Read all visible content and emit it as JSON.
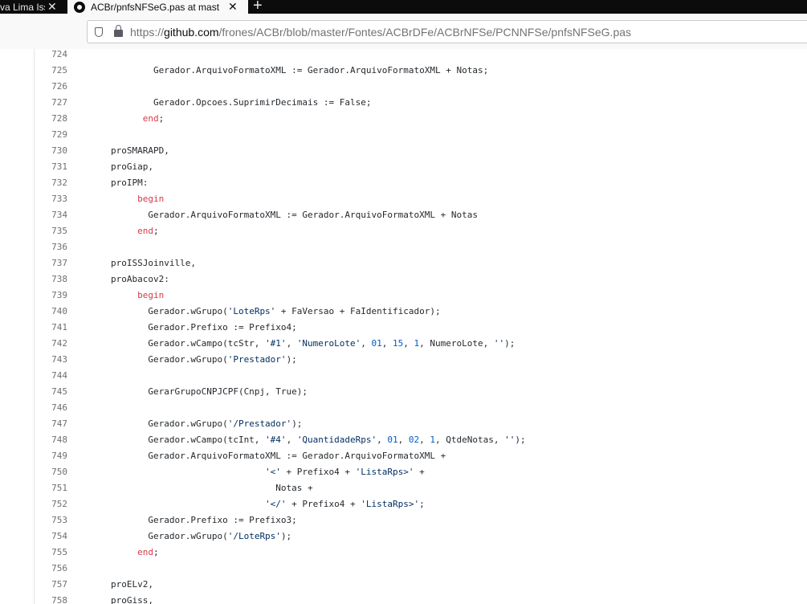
{
  "tabs": [
    {
      "title": "va Lima Iss",
      "active": false,
      "close": "✕"
    },
    {
      "title": "ACBr/pnfsNFSeG.pas at master",
      "active": true,
      "close": "✕"
    }
  ],
  "new_tab_label": "+",
  "address": {
    "scheme": "https://",
    "host": "github.com",
    "path": "/frones/ACBr/blob/master/Fontes/ACBrDFe/ACBrNFSe/PCNNFSe/pnfsNFSeG.pas"
  },
  "code": {
    "lines": [
      {
        "n": "724",
        "segs": []
      },
      {
        "n": "725",
        "segs": [
          {
            "t": "        Gerador.ArquivoFormatoXML := Gerador.ArquivoFormatoXML + Notas;",
            "c": ""
          }
        ]
      },
      {
        "n": "726",
        "segs": []
      },
      {
        "n": "727",
        "segs": [
          {
            "t": "        Gerador.Opcoes.SuprimirDecimais := False;",
            "c": ""
          }
        ]
      },
      {
        "n": "728",
        "segs": [
          {
            "t": "      ",
            "c": ""
          },
          {
            "t": "end",
            "c": "kw"
          },
          {
            "t": ";",
            "c": ""
          }
        ]
      },
      {
        "n": "729",
        "segs": []
      },
      {
        "n": "730",
        "segs": [
          {
            "t": "proSMARAPD,",
            "c": ""
          }
        ]
      },
      {
        "n": "731",
        "segs": [
          {
            "t": "proGiap,",
            "c": ""
          }
        ]
      },
      {
        "n": "732",
        "segs": [
          {
            "t": "proIPM:",
            "c": ""
          }
        ]
      },
      {
        "n": "733",
        "segs": [
          {
            "t": "     ",
            "c": ""
          },
          {
            "t": "begin",
            "c": "kw"
          }
        ]
      },
      {
        "n": "734",
        "segs": [
          {
            "t": "       Gerador.ArquivoFormatoXML := Gerador.ArquivoFormatoXML + Notas",
            "c": ""
          }
        ]
      },
      {
        "n": "735",
        "segs": [
          {
            "t": "     ",
            "c": ""
          },
          {
            "t": "end",
            "c": "kw"
          },
          {
            "t": ";",
            "c": ""
          }
        ]
      },
      {
        "n": "736",
        "segs": []
      },
      {
        "n": "737",
        "segs": [
          {
            "t": "proISSJoinville,",
            "c": ""
          }
        ]
      },
      {
        "n": "738",
        "segs": [
          {
            "t": "proAbacov2:",
            "c": ""
          }
        ]
      },
      {
        "n": "739",
        "segs": [
          {
            "t": "     ",
            "c": ""
          },
          {
            "t": "begin",
            "c": "kw"
          }
        ]
      },
      {
        "n": "740",
        "segs": [
          {
            "t": "       Gerador.wGrupo(",
            "c": ""
          },
          {
            "t": "'LoteRps'",
            "c": "str"
          },
          {
            "t": " + FaVersao + FaIdentificador);",
            "c": ""
          }
        ]
      },
      {
        "n": "741",
        "segs": [
          {
            "t": "       Gerador.Prefixo := Prefixo4;",
            "c": ""
          }
        ]
      },
      {
        "n": "742",
        "segs": [
          {
            "t": "       Gerador.wCampo(tcStr, ",
            "c": ""
          },
          {
            "t": "'#1'",
            "c": "str"
          },
          {
            "t": ", ",
            "c": ""
          },
          {
            "t": "'NumeroLote'",
            "c": "str"
          },
          {
            "t": ", ",
            "c": ""
          },
          {
            "t": "01",
            "c": "num"
          },
          {
            "t": ", ",
            "c": ""
          },
          {
            "t": "15",
            "c": "num"
          },
          {
            "t": ", ",
            "c": ""
          },
          {
            "t": "1",
            "c": "num"
          },
          {
            "t": ", NumeroLote, ",
            "c": ""
          },
          {
            "t": "''",
            "c": "str"
          },
          {
            "t": ");",
            "c": ""
          }
        ]
      },
      {
        "n": "743",
        "segs": [
          {
            "t": "       Gerador.wGrupo(",
            "c": ""
          },
          {
            "t": "'Prestador'",
            "c": "str"
          },
          {
            "t": ");",
            "c": ""
          }
        ]
      },
      {
        "n": "744",
        "segs": []
      },
      {
        "n": "745",
        "segs": [
          {
            "t": "       GerarGrupoCNPJCPF(Cnpj, True);",
            "c": ""
          }
        ]
      },
      {
        "n": "746",
        "segs": []
      },
      {
        "n": "747",
        "segs": [
          {
            "t": "       Gerador.wGrupo(",
            "c": ""
          },
          {
            "t": "'/Prestador'",
            "c": "str"
          },
          {
            "t": ");",
            "c": ""
          }
        ]
      },
      {
        "n": "748",
        "segs": [
          {
            "t": "       Gerador.wCampo(tcInt, ",
            "c": ""
          },
          {
            "t": "'#4'",
            "c": "str"
          },
          {
            "t": ", ",
            "c": ""
          },
          {
            "t": "'QuantidadeRps'",
            "c": "str"
          },
          {
            "t": ", ",
            "c": ""
          },
          {
            "t": "01",
            "c": "num"
          },
          {
            "t": ", ",
            "c": ""
          },
          {
            "t": "02",
            "c": "num"
          },
          {
            "t": ", ",
            "c": ""
          },
          {
            "t": "1",
            "c": "num"
          },
          {
            "t": ", QtdeNotas, ",
            "c": ""
          },
          {
            "t": "''",
            "c": "str"
          },
          {
            "t": ");",
            "c": ""
          }
        ]
      },
      {
        "n": "749",
        "segs": [
          {
            "t": "       Gerador.ArquivoFormatoXML := Gerador.ArquivoFormatoXML +",
            "c": ""
          }
        ]
      },
      {
        "n": "750",
        "segs": [
          {
            "t": "                             ",
            "c": ""
          },
          {
            "t": "'<'",
            "c": "str"
          },
          {
            "t": " + Prefixo4 + ",
            "c": ""
          },
          {
            "t": "'ListaRps>'",
            "c": "str"
          },
          {
            "t": " +",
            "c": ""
          }
        ]
      },
      {
        "n": "751",
        "segs": [
          {
            "t": "                               Notas +",
            "c": ""
          }
        ]
      },
      {
        "n": "752",
        "segs": [
          {
            "t": "                             ",
            "c": ""
          },
          {
            "t": "'</'",
            "c": "str"
          },
          {
            "t": " + Prefixo4 + ",
            "c": ""
          },
          {
            "t": "'ListaRps>'",
            "c": "str"
          },
          {
            "t": ";",
            "c": ""
          }
        ]
      },
      {
        "n": "753",
        "segs": [
          {
            "t": "       Gerador.Prefixo := Prefixo3;",
            "c": ""
          }
        ]
      },
      {
        "n": "754",
        "segs": [
          {
            "t": "       Gerador.wGrupo(",
            "c": ""
          },
          {
            "t": "'/LoteRps'",
            "c": "str"
          },
          {
            "t": ");",
            "c": ""
          }
        ]
      },
      {
        "n": "755",
        "segs": [
          {
            "t": "     ",
            "c": ""
          },
          {
            "t": "end",
            "c": "kw"
          },
          {
            "t": ";",
            "c": ""
          }
        ]
      },
      {
        "n": "756",
        "segs": []
      },
      {
        "n": "757",
        "segs": [
          {
            "t": "proELv2,",
            "c": ""
          }
        ]
      },
      {
        "n": "758",
        "segs": [
          {
            "t": "proGiss,",
            "c": ""
          }
        ]
      }
    ]
  }
}
